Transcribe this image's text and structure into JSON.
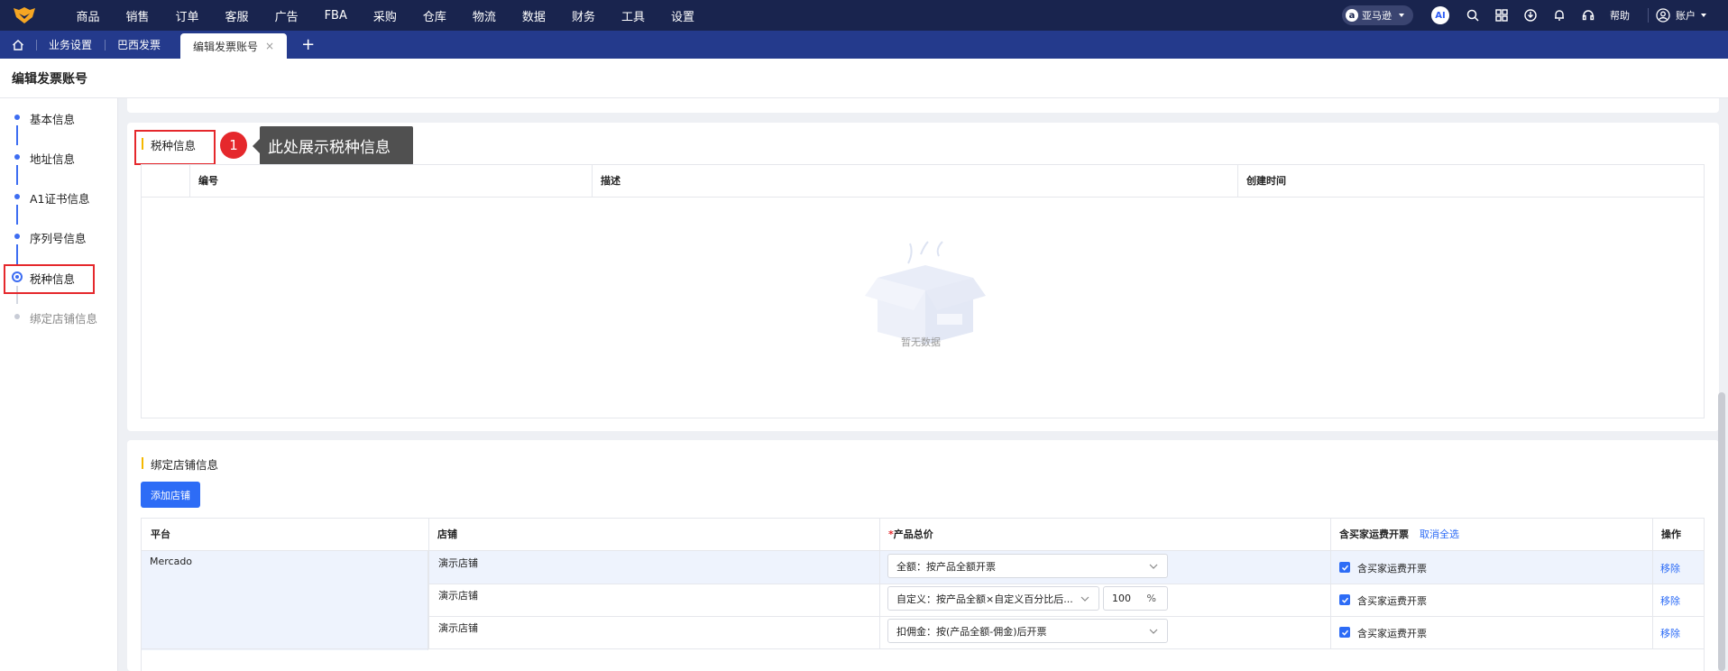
{
  "nav": {
    "items": [
      "商品",
      "销售",
      "订单",
      "客服",
      "广告",
      "FBA",
      "采购",
      "仓库",
      "物流",
      "数据",
      "财务",
      "工具",
      "设置"
    ],
    "platform": "亚马逊",
    "ai": "AI",
    "help": "帮助",
    "account": "账户"
  },
  "tabs": {
    "items": [
      "业务设置",
      "巴西发票"
    ],
    "active": "编辑发票账号",
    "close": "×",
    "add": "+"
  },
  "page": {
    "title": "编辑发票账号"
  },
  "steps": [
    "基本信息",
    "地址信息",
    "A1证书信息",
    "序列号信息",
    "税种信息",
    "绑定店铺信息"
  ],
  "tax": {
    "title": "税种信息",
    "columns": [
      "编号",
      "描述",
      "创建时间"
    ],
    "empty": "暂无数据"
  },
  "annotation": {
    "number": "1",
    "text": "此处展示税种信息"
  },
  "shops": {
    "title": "绑定店铺信息",
    "add_button": "添加店铺",
    "columns": {
      "platform": "平台",
      "shop": "店铺",
      "price_required": "*",
      "price": "产品总价",
      "shipping": "含买家运费开票",
      "deselect": "取消全选",
      "action": "操作"
    },
    "platform_value": "Mercado",
    "rows": [
      {
        "shop": "演示店铺",
        "price": "全额：按产品全额开票",
        "percent": "",
        "shipping": "含买家运费开票",
        "action": "移除"
      },
      {
        "shop": "演示店铺",
        "price": "自定义：按产品全额×自定义百分比后...",
        "percent": "100",
        "shipping": "含买家运费开票",
        "action": "移除"
      },
      {
        "shop": "演示店铺",
        "price": "扣佣金：按(产品全额-佣金)后开票",
        "percent": "",
        "shipping": "含买家运费开票",
        "action": "移除"
      }
    ],
    "percent_unit": "%"
  },
  "colors": {
    "nav_bg": "#19244e",
    "tab_bg": "#243a8c",
    "accent": "#2d6cf6",
    "highlight": "#e5282c",
    "section_mark": "#f5b800"
  }
}
